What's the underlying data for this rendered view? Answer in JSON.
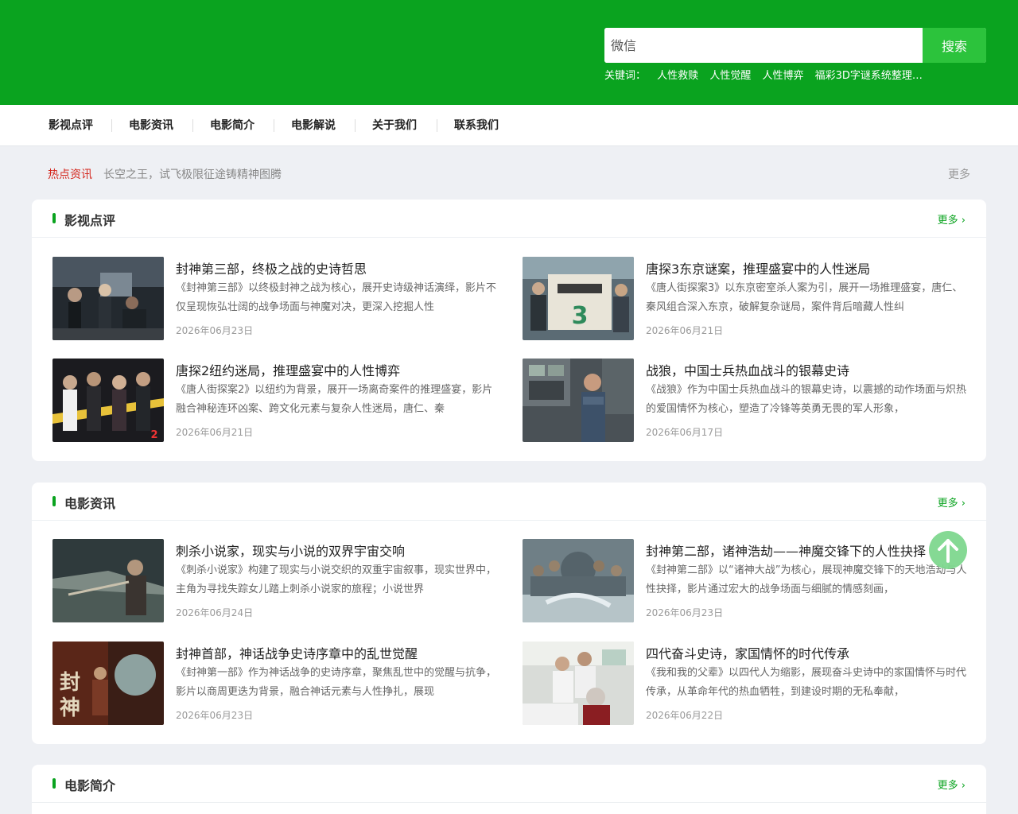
{
  "search": {
    "placeholder": "微信",
    "button": "搜索"
  },
  "keywords": {
    "label": "关键词：",
    "items": [
      "人性救赎",
      "人性觉醒",
      "人性博弈",
      "福彩3D字谜系统整理…"
    ]
  },
  "nav": [
    "影视点评",
    "电影资讯",
    "电影简介",
    "电影解说",
    "关于我们",
    "联系我们"
  ],
  "hot": {
    "label": "热点资讯",
    "text": "长空之王，试飞极限征途铸精神图腾",
    "more": "更多"
  },
  "sections": [
    {
      "title": "影视点评",
      "more": "更多",
      "items": [
        {
          "title": "封神第三部，终极之战的史诗哲思",
          "desc": "《封神第三部》以终极封神之战为核心，展开史诗级神话演绎，影片不仅呈现恢弘壮阔的战争场面与神魔对决，更深入挖掘人性",
          "date": "2026年06月23日"
        },
        {
          "title": "唐探3东京谜案，推理盛宴中的人性迷局",
          "desc": "《唐人街探案3》以东京密室杀人案为引，展开一场推理盛宴，唐仁、秦风组合深入东京，破解复杂谜局，案件背后暗藏人性纠",
          "date": "2026年06月21日"
        },
        {
          "title": "唐探2纽约迷局，推理盛宴中的人性博弈",
          "desc": "《唐人街探案2》以纽约为背景，展开一场离奇案件的推理盛宴，影片融合神秘连环凶案、跨文化元素与复杂人性迷局，唐仁、秦",
          "date": "2026年06月21日"
        },
        {
          "title": "战狼，中国士兵热血战斗的银幕史诗",
          "desc": "《战狼》作为中国士兵热血战斗的银幕史诗，以震撼的动作场面与炽热的爱国情怀为核心，塑造了冷锋等英勇无畏的军人形象，",
          "date": "2026年06月17日"
        }
      ]
    },
    {
      "title": "电影资讯",
      "more": "更多",
      "items": [
        {
          "title": "刺杀小说家，现实与小说的双界宇宙交响",
          "desc": "《刺杀小说家》构建了现实与小说交织的双重宇宙叙事，现实世界中，主角为寻找失踪女儿踏上刺杀小说家的旅程；小说世界",
          "date": "2026年06月24日"
        },
        {
          "title": "封神第二部，诸神浩劫——神魔交锋下的人性抉择",
          "desc": "《封神第二部》以“诸神大战”为核心，展现神魔交锋下的天地浩劫与人性抉择，影片通过宏大的战争场面与细腻的情感刻画，",
          "date": "2026年06月23日"
        },
        {
          "title": "封神首部，神话战争史诗序章中的乱世觉醒",
          "desc": "《封神第一部》作为神话战争的史诗序章，聚焦乱世中的觉醒与抗争，影片以商周更迭为背景，融合神话元素与人性挣扎，展现",
          "date": "2026年06月23日"
        },
        {
          "title": "四代奋斗史诗，家国情怀的时代传承",
          "desc": "《我和我的父辈》以四代人为缩影，展现奋斗史诗中的家国情怀与时代传承，从革命年代的热血牺牲，到建设时期的无私奉献，",
          "date": "2026年06月22日"
        }
      ]
    },
    {
      "title": "电影简介",
      "more": "更多",
      "items": []
    }
  ]
}
